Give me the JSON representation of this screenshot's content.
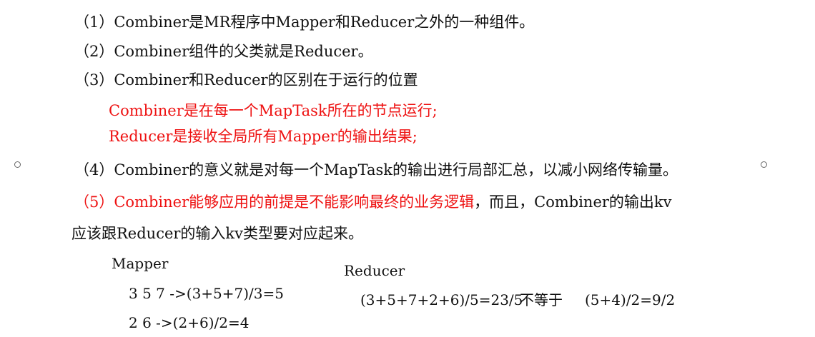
{
  "items": {
    "p1": "（1）Combiner是MR程序中Mapper和Reducer之外的一种组件。",
    "p2": "（2）Combiner组件的父类就是Reducer。",
    "p3": "（3）Combiner和Reducer的区别在于运行的位置",
    "p3a": "Combiner是在每一个MapTask所在的节点运行;",
    "p3b": "Reducer是接收全局所有Mapper的输出结果;",
    "p4": "（4）Combiner的意义就是对每一个MapTask的输出进行局部汇总，以减小网络传输量。",
    "p5_red": "（5）Combiner能够应用的前提是不能影响最终的业务逻辑",
    "p5_black": "，而且，Combiner的输出kv",
    "p5_cont": "应该跟Reducer的输入kv类型要对应起来。"
  },
  "example": {
    "mapper_label": "Mapper",
    "mapper_line1": "3 5 7 ->(3+5+7)/3=5",
    "mapper_line2": "2 6 ->(2+6)/2=4",
    "reducer_label": "Reducer",
    "reducer_calc_left": "(3+5+7+2+6)/5=23/5",
    "not_equal": "不等于",
    "reducer_calc_right": "(5+4)/2=9/2"
  },
  "colors": {
    "text": "#111111",
    "highlight_red": "#ee1111"
  }
}
